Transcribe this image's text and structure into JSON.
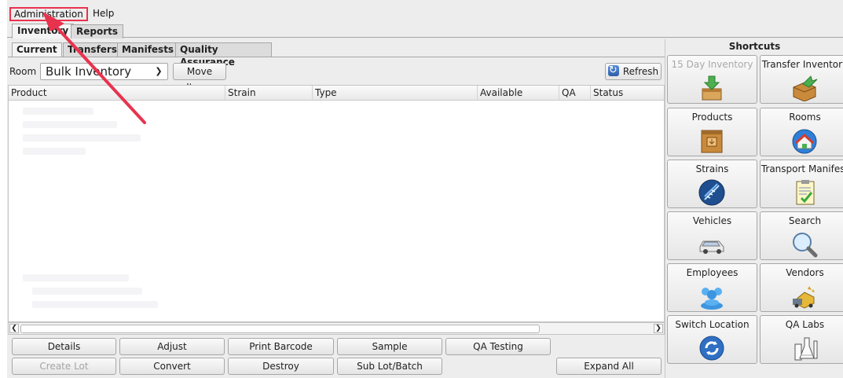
{
  "menu": {
    "items": [
      "Administration",
      "Help"
    ]
  },
  "top_tabs": [
    "Inventory",
    "Reports"
  ],
  "sub_tabs": [
    "Current",
    "Transfers",
    "Manifests",
    "Quality Assurance"
  ],
  "toolbar": {
    "room_label": "Room",
    "room_value": "Bulk Inventory",
    "move_items": "Move Items",
    "refresh": "Refresh"
  },
  "table": {
    "columns": [
      "Product",
      "Strain",
      "Type",
      "Available",
      "QA",
      "Status"
    ]
  },
  "actions": {
    "row1": [
      "Details",
      "Adjust",
      "Print Barcode",
      "Sample",
      "QA Testing"
    ],
    "row2": [
      "Create Lot",
      "Convert",
      "Destroy",
      "Sub Lot/Batch",
      "Expand All"
    ]
  },
  "shortcuts": {
    "title": "Shortcuts",
    "items": [
      {
        "label": "15 Day Inventory",
        "icon": "inventory-box-arrow-icon",
        "disabled": true
      },
      {
        "label": "Transfer Inventory",
        "icon": "transfer-box-icon",
        "disabled": false
      },
      {
        "label": "Products",
        "icon": "product-box-icon",
        "disabled": false
      },
      {
        "label": "Rooms",
        "icon": "house-globe-icon",
        "disabled": false
      },
      {
        "label": "Strains",
        "icon": "dna-icon",
        "disabled": false
      },
      {
        "label": "Transport Manifest",
        "icon": "clipboard-check-icon",
        "disabled": false
      },
      {
        "label": "Vehicles",
        "icon": "car-icon",
        "disabled": false
      },
      {
        "label": "Search",
        "icon": "magnifier-icon",
        "disabled": false
      },
      {
        "label": "Employees",
        "icon": "people-icon",
        "disabled": false
      },
      {
        "label": "Vendors",
        "icon": "vendor-truck-icon",
        "disabled": false
      },
      {
        "label": "Switch Location",
        "icon": "switch-arrows-icon",
        "disabled": false
      },
      {
        "label": "QA Labs",
        "icon": "lab-flask-icon",
        "disabled": false
      }
    ]
  },
  "colors": {
    "highlight": "#e8334e",
    "accent": "#2f6fc4"
  }
}
